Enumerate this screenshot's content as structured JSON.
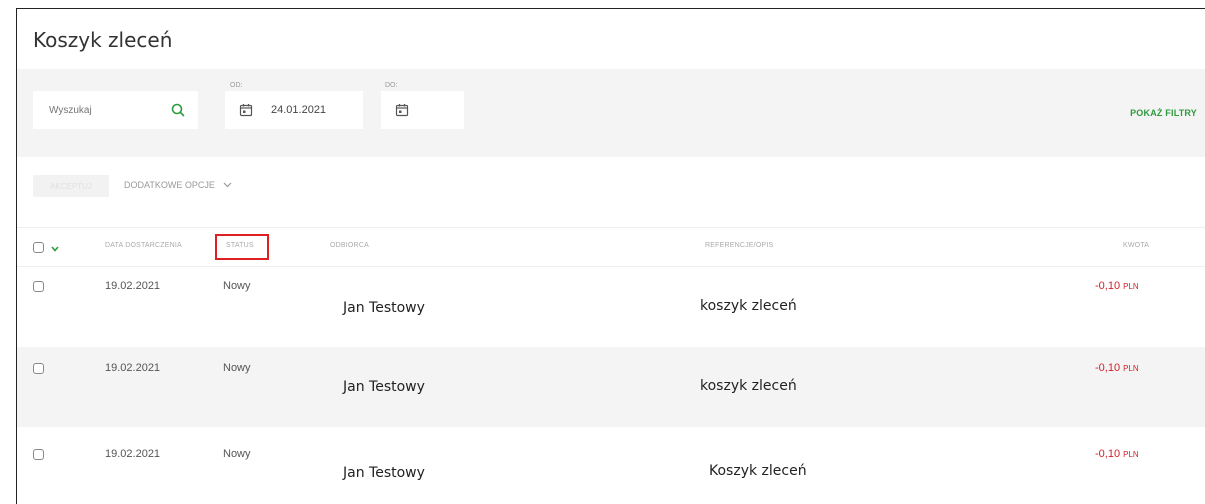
{
  "page": {
    "title": "Koszyk zleceń"
  },
  "filters": {
    "search_placeholder": "Wyszukaj",
    "from_label": "OD:",
    "from_value": "24.01.2021",
    "to_label": "DO:",
    "to_value": "",
    "show_filters": "POKAŻ FILTRY"
  },
  "actions": {
    "accept": "AKCEPTUJ",
    "more_options": "DODATKOWE OPCJE"
  },
  "table": {
    "headers": {
      "delivery_date": "DATA DOSTARCZENIA",
      "status": "STATUS",
      "recipient": "ODBIORCA",
      "reference": "REFERENCJE/OPIS",
      "amount": "KWOTA"
    },
    "rows": [
      {
        "date": "19.02.2021",
        "status": "Nowy",
        "recipient": "Jan Testowy",
        "reference": "koszyk zleceń",
        "amount": "-0,10",
        "currency": "PLN"
      },
      {
        "date": "19.02.2021",
        "status": "Nowy",
        "recipient": "Jan Testowy",
        "reference": "koszyk zleceń",
        "amount": "-0,10",
        "currency": "PLN"
      },
      {
        "date": "19.02.2021",
        "status": "Nowy",
        "recipient": "Jan Testowy",
        "reference": "Koszyk zleceń",
        "amount": "-0,10",
        "currency": "PLN"
      }
    ]
  },
  "colors": {
    "accent_green": "#2e9b3c",
    "negative_red": "#d0202c",
    "highlight_border": "#e02020"
  },
  "icons": [
    "search-icon",
    "calendar-icon",
    "chevron-down-icon",
    "checkbox"
  ]
}
